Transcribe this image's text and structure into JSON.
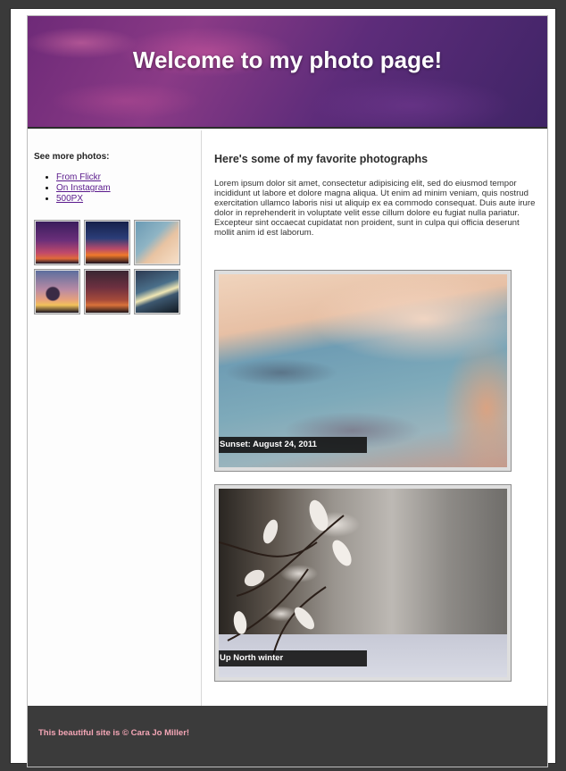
{
  "header": {
    "title": "Welcome to my photo page!"
  },
  "sidebar": {
    "heading": "See more photos:",
    "links": [
      {
        "label": "From Flickr"
      },
      {
        "label": "On Instagram"
      },
      {
        "label": "500PX"
      }
    ],
    "thumbnails_count": 6
  },
  "main": {
    "heading": "Here's some of my favorite photographs",
    "paragraph": "Lorem ipsum dolor sit amet, consectetur adipisicing elit, sed do eiusmod tempor incididunt ut labore et dolore magna aliqua. Ut enim ad minim veniam, quis nostrud exercitation ullamco laboris nisi ut aliquip ex ea commodo consequat. Duis aute irure dolor in reprehenderit in voluptate velit esse cillum dolore eu fugiat nulla pariatur. Excepteur sint occaecat cupidatat non proident, sunt in culpa qui officia deserunt mollit anim id est laborum.",
    "photos": [
      {
        "caption": "Sunset: August 24, 2011"
      },
      {
        "caption": "Up North winter"
      }
    ]
  },
  "footer": {
    "text": "This beautiful site is © Cara Jo Miller!"
  },
  "colors": {
    "header": "#6e2a78",
    "link": "#5a1a8c",
    "footer_bg": "#3b3b3b",
    "footer_text": "#f4a6b6"
  }
}
